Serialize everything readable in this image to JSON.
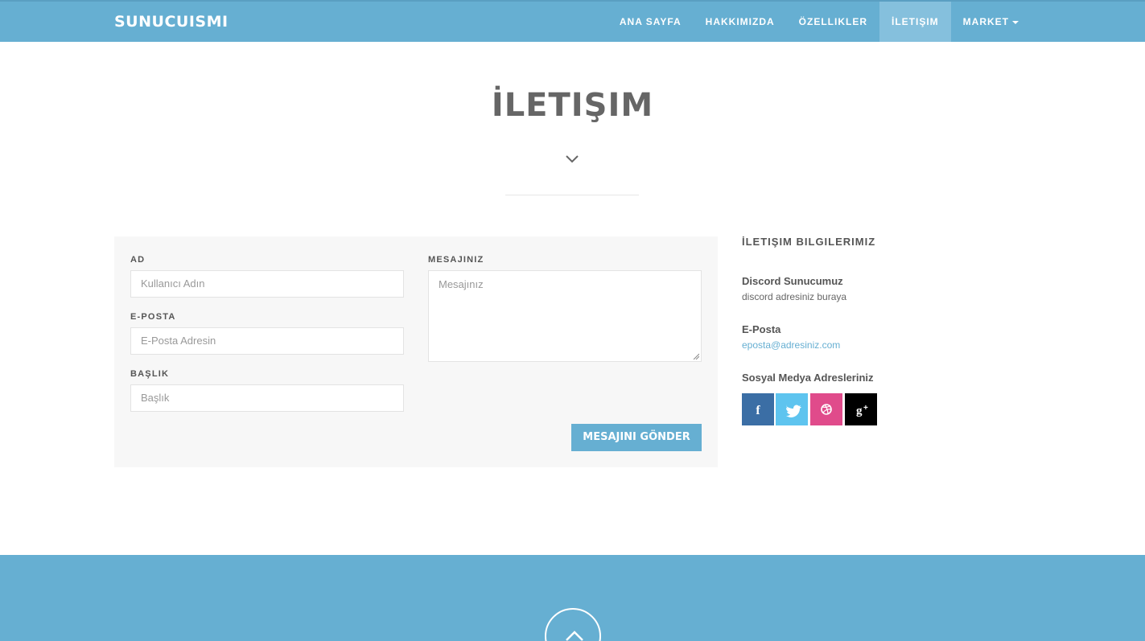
{
  "navbar": {
    "brand": "SUNUCUISMI",
    "links": [
      {
        "label": "ANA SAYFA"
      },
      {
        "label": "HAKKIMIZDA"
      },
      {
        "label": "ÖZELLIKLER"
      },
      {
        "label": "İLETIŞIM",
        "active": true
      },
      {
        "label": "MARKET",
        "dropdown": true
      }
    ]
  },
  "page": {
    "title": "İLETIŞIM",
    "chevron_icon": "chevron-down-icon"
  },
  "form": {
    "name_label": "AD",
    "name_placeholder": "Kullanıcı Adın",
    "email_label": "E-POSTA",
    "email_placeholder": "E-Posta Adresin",
    "subject_label": "BAŞLIK",
    "subject_placeholder": "Başlık",
    "message_label": "MESAJINIZ",
    "message_placeholder": "Mesajınız",
    "submit_label": "MESAJINI GÖNDER"
  },
  "contact": {
    "title": "İLETIŞIM BILGILERIMIZ",
    "discord_heading": "Discord Sunucumuz",
    "discord_text": "discord adresiniz buraya",
    "email_heading": "E-Posta",
    "email_text": "eposta@adresiniz.com",
    "social_heading": "Sosyal Medya Adresleriniz",
    "social": [
      {
        "icon": "facebook-icon",
        "glyph": "f",
        "color": "#3b6ea5"
      },
      {
        "icon": "twitter-icon",
        "glyph": "t",
        "color": "#5ec4ef"
      },
      {
        "icon": "dribbble-icon",
        "glyph": "d",
        "color": "#e04b8b"
      },
      {
        "icon": "google-plus-icon",
        "glyph": "g+",
        "color": "#000000"
      }
    ]
  },
  "colors": {
    "accent": "#66afd2",
    "panel": "#f7f7f7",
    "text": "#666666"
  }
}
